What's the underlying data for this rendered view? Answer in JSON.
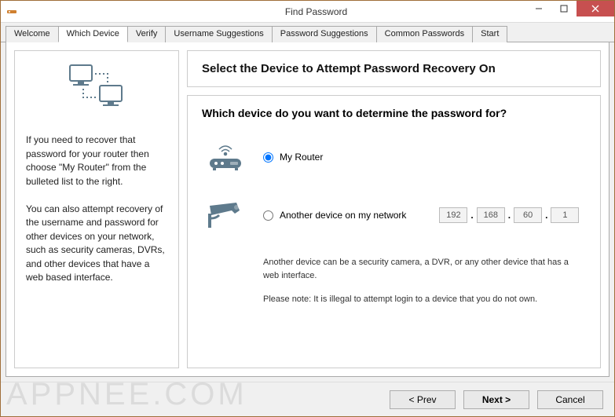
{
  "window": {
    "title": "Find Password"
  },
  "tabs": [
    {
      "label": "Welcome"
    },
    {
      "label": "Which Device"
    },
    {
      "label": "Verify"
    },
    {
      "label": "Username Suggestions"
    },
    {
      "label": "Password Suggestions"
    },
    {
      "label": "Common Passwords"
    },
    {
      "label": "Start"
    }
  ],
  "active_tab_index": 1,
  "sidebar": {
    "para1": "If you need to recover that password for your router then choose \"My Router\" from the bulleted list to the right.",
    "para2": "You can also attempt recovery of the username and password for other devices on your network, such as security cameras, DVRs, and other devices that have a web based interface."
  },
  "main": {
    "heading": "Select the Device to Attempt Password Recovery On",
    "question": "Which device do you want to determine the password for?",
    "option_router": "My Router",
    "option_other": "Another device on my network",
    "ip": {
      "a": "192",
      "b": "168",
      "c": "60",
      "d": "1"
    },
    "hint1": "Another device can be a security camera, a DVR, or any other device that has a web interface.",
    "hint2": "Please note: It is illegal to attempt login to a device that you do not own."
  },
  "footer": {
    "prev": "< Prev",
    "next": "Next >",
    "cancel": "Cancel"
  },
  "watermark": "APPNEE.COM"
}
